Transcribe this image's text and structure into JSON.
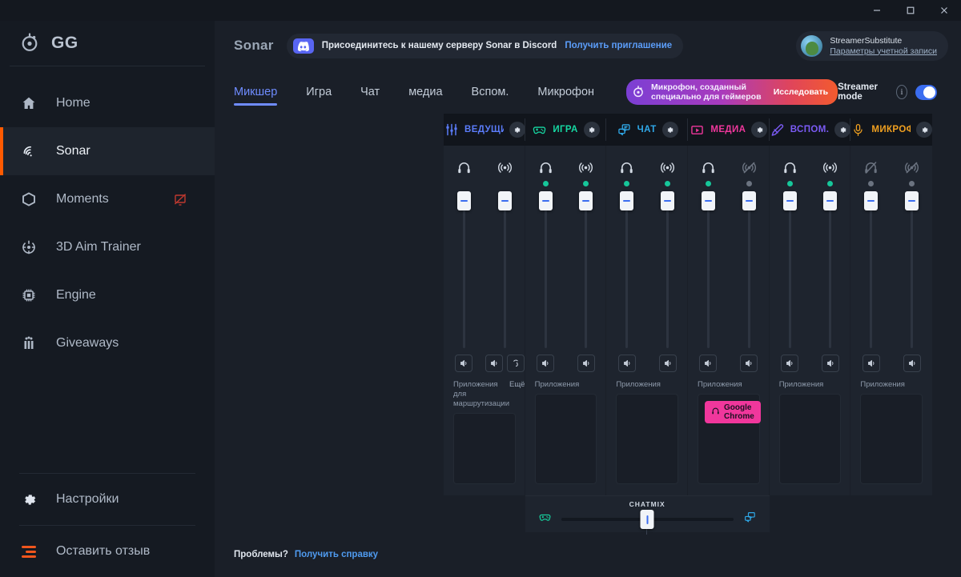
{
  "window": {
    "minimize": "minimize-icon",
    "maximize": "maximize-icon",
    "close": "close-icon"
  },
  "sidebar": {
    "brand": "GG",
    "items": [
      {
        "label": "Home",
        "icon": "home-icon",
        "active": false
      },
      {
        "label": "Sonar",
        "icon": "sonar-icon",
        "active": true
      },
      {
        "label": "Moments",
        "icon": "hexagon-icon",
        "active": false,
        "badge": "screen-off-icon"
      },
      {
        "label": "3D Aim Trainer",
        "icon": "crosshair-icon",
        "active": false
      },
      {
        "label": "Engine",
        "icon": "chip-icon",
        "active": false
      },
      {
        "label": "Giveaways",
        "icon": "gift-icon",
        "active": false
      }
    ],
    "settings": {
      "label": "Настройки",
      "icon": "gear-icon"
    },
    "feedback": {
      "label": "Оставить отзыв",
      "icon": "feedback-icon"
    }
  },
  "topbar": {
    "app_title": "Sonar",
    "discord_text": "Присоединитесь к нашему серверу Sonar в Discord",
    "discord_link": "Получить приглашение",
    "account_name": "StreamerSubstitute",
    "account_link": "Параметры учетной записи"
  },
  "tabs": {
    "items": [
      {
        "label": "Микшер",
        "active": true
      },
      {
        "label": "Игра",
        "active": false
      },
      {
        "label": "Чат",
        "active": false
      },
      {
        "label": "медиа",
        "active": false
      },
      {
        "label": "Вспом.",
        "active": false
      },
      {
        "label": "Микрофон",
        "active": false
      }
    ],
    "promo_text": "Микрофон, созданный специально для геймеров",
    "promo_cta": "Исследовать",
    "streamer_mode_label": "Streamer mode",
    "streamer_mode_on": true,
    "info_glyph": "i"
  },
  "mixer": {
    "strips": [
      {
        "title": "ВЕДУЩИЙ ЭЛЕМЕНТ",
        "icon": "sliders-icon",
        "color": "#5b7cfa",
        "apps_label": "Приложения для маршрутизации",
        "more_label": "Ещё",
        "faders": [
          {
            "icon": "headphones-icon",
            "state": "none",
            "buttons": [
              "speaker-icon"
            ]
          },
          {
            "icon": "broadcast-icon",
            "state": "none",
            "buttons": [
              "speaker-icon",
              "monitor-icon"
            ]
          }
        ],
        "apps": []
      },
      {
        "title": "ИГРА",
        "icon": "gamepad-icon",
        "color": "#16d9a3",
        "apps_label": "Приложения",
        "faders": [
          {
            "icon": "headphones-icon",
            "state": "on",
            "buttons": [
              "speaker-icon"
            ]
          },
          {
            "icon": "broadcast-icon",
            "state": "on",
            "buttons": [
              "speaker-icon"
            ]
          }
        ],
        "apps": []
      },
      {
        "title": "ЧАТ",
        "icon": "chat-icon",
        "color": "#2fa8e8",
        "apps_label": "Приложения",
        "faders": [
          {
            "icon": "headphones-icon",
            "state": "on",
            "buttons": [
              "speaker-icon"
            ]
          },
          {
            "icon": "broadcast-icon",
            "state": "on",
            "buttons": [
              "speaker-icon"
            ]
          }
        ],
        "apps": []
      },
      {
        "title": "МЕДИА",
        "icon": "media-icon",
        "color": "#f0379c",
        "apps_label": "Приложения",
        "faders": [
          {
            "icon": "headphones-icon",
            "state": "on",
            "buttons": [
              "speaker-icon"
            ]
          },
          {
            "icon": "broadcast-muted-icon",
            "state": "off",
            "buttons": [
              "speaker-icon"
            ]
          }
        ],
        "apps": [
          {
            "name": "Google Chrome",
            "icon": "headphones-icon"
          }
        ]
      },
      {
        "title": "ВСПОМ.",
        "icon": "pen-icon",
        "color": "#7b5bf5",
        "apps_label": "Приложения",
        "faders": [
          {
            "icon": "headphones-icon",
            "state": "on",
            "buttons": [
              "speaker-icon"
            ]
          },
          {
            "icon": "broadcast-icon",
            "state": "on",
            "buttons": [
              "speaker-icon"
            ]
          }
        ],
        "apps": []
      },
      {
        "title": "МИКРОФОН",
        "icon": "mic-icon",
        "color": "#f0a020",
        "apps_label": "Приложения",
        "faders": [
          {
            "icon": "headphones-muted-icon",
            "state": "off",
            "buttons": [
              "speaker-icon"
            ]
          },
          {
            "icon": "broadcast-muted-icon",
            "state": "off",
            "buttons": [
              "speaker-icon"
            ]
          }
        ],
        "apps": []
      }
    ],
    "chatmix": {
      "title": "CHATMIX",
      "left_icon": "gamepad-icon",
      "right_icon": "chat-icon",
      "value": 50
    }
  },
  "footer": {
    "question": "Проблемы?",
    "link": "Получить справку"
  }
}
